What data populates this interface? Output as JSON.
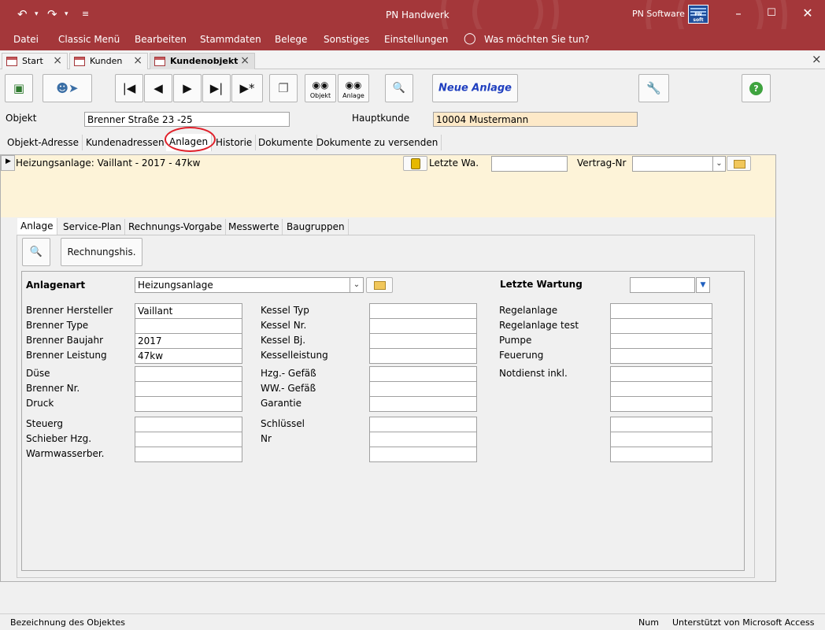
{
  "window": {
    "title": "PN Handwerk",
    "brand": "PN Software",
    "brand_logo_text": "PN soft"
  },
  "menu": [
    "Datei",
    "Classic Menü",
    "Bearbeiten",
    "Stammdaten",
    "Belege",
    "Sonstiges",
    "Einstellungen"
  ],
  "tell_me": "Was möchten Sie tun?",
  "doc_tabs": [
    {
      "label": "Start",
      "active": false
    },
    {
      "label": "Kunden",
      "active": false
    },
    {
      "label": "Kundenobjekt",
      "active": true
    }
  ],
  "toolbar": {
    "objekt_label": "Objekt",
    "anlage_label": "Anlage",
    "neue_anlage": "Neue Anlage"
  },
  "header": {
    "objekt_label": "Objekt",
    "objekt_value": "Brenner Straße 23 -25",
    "hauptkunde_label": "Hauptkunde",
    "hauptkunde_value": "10004 Mustermann"
  },
  "main_tabs": [
    "Objekt-Adresse",
    "Kundenadressen",
    "Anlagen",
    "Historie",
    "Dokumente",
    "Dokumente zu versenden"
  ],
  "record": {
    "title": "Heizungsanlage: Vaillant  - 2017 - 47kw",
    "letzte_wa_label": "Letzte Wa.",
    "letzte_wa_value": "",
    "vertrag_label": "Vertrag-Nr",
    "vertrag_value": ""
  },
  "sub_tabs": [
    "Anlage",
    "Service-Plan",
    "Rechnungs-Vorgabe",
    "Messwerte",
    "Baugruppen"
  ],
  "rechnungshis_label": "Rechnungshis.",
  "anlage": {
    "anlagenart_label": "Anlagenart",
    "anlagenart_value": "Heizungsanlage",
    "letzte_wartung_label": "Letzte Wartung",
    "letzte_wartung_value": ""
  },
  "col1": [
    {
      "label": "Brenner Hersteller",
      "value": "Vaillant"
    },
    {
      "label": "Brenner Type",
      "value": ""
    },
    {
      "label": "Brenner Baujahr",
      "value": "2017"
    },
    {
      "label": "Brenner Leistung",
      "value": "47kw"
    },
    {
      "label": "Düse",
      "value": ""
    },
    {
      "label": "Brenner Nr.",
      "value": ""
    },
    {
      "label": "Druck",
      "value": ""
    },
    {
      "label": "Steuerg",
      "value": ""
    },
    {
      "label": "Schieber Hzg.",
      "value": ""
    },
    {
      "label": "Warmwasserber.",
      "value": ""
    }
  ],
  "col2": [
    {
      "label": "Kessel Typ",
      "value": ""
    },
    {
      "label": "Kessel Nr.",
      "value": ""
    },
    {
      "label": "Kessel Bj.",
      "value": ""
    },
    {
      "label": "Kesselleistung",
      "value": ""
    },
    {
      "label": "Hzg.- Gefäß",
      "value": ""
    },
    {
      "label": "WW.- Gefäß",
      "value": ""
    },
    {
      "label": "Garantie",
      "value": ""
    },
    {
      "label": "Schlüssel",
      "value": ""
    },
    {
      "label": "Nr",
      "value": ""
    },
    {
      "label": "",
      "value": ""
    }
  ],
  "col3": [
    {
      "label": "Regelanlage",
      "value": ""
    },
    {
      "label": "Regelanlage test",
      "value": ""
    },
    {
      "label": "Pumpe",
      "value": ""
    },
    {
      "label": "Feuerung",
      "value": ""
    },
    {
      "label": "Notdienst inkl.",
      "value": ""
    },
    {
      "label": "",
      "value": ""
    },
    {
      "label": "",
      "value": ""
    },
    {
      "label": "",
      "value": ""
    },
    {
      "label": "",
      "value": ""
    },
    {
      "label": "",
      "value": ""
    }
  ],
  "status": {
    "left": "Bezeichnung des Objektes",
    "num": "Num",
    "right": "Unterstützt von Microsoft Access"
  },
  "colors": {
    "title_bar": "#a4373a",
    "record_band": "#fdf3d8",
    "highlight_field": "#fde9c8",
    "annotation_circle": "#e0202a",
    "neue_anlage_text": "#1f3fbf"
  }
}
